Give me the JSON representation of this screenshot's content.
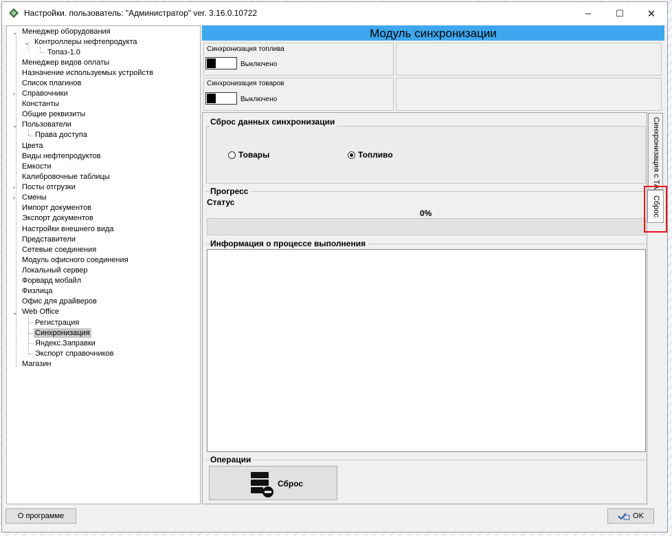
{
  "window": {
    "title": "Настройки. пользователь: \"Администратор\" ver. 3.16.0.10722",
    "minimize": "–",
    "maximize": "☐",
    "close": "✕"
  },
  "tree": {
    "items": [
      {
        "label": "Менеджер оборудования"
      },
      {
        "label": "Контроллеры нефтепродукта"
      },
      {
        "label": "Топаз-1.0"
      },
      {
        "label": "Менеджер видов оплаты"
      },
      {
        "label": "Назначение используемых устройств"
      },
      {
        "label": "Список плагинов"
      },
      {
        "label": "Справочники"
      },
      {
        "label": "Константы"
      },
      {
        "label": "Общие реквизиты"
      },
      {
        "label": "Пользователи"
      },
      {
        "label": "Права доступа"
      },
      {
        "label": "Цвета"
      },
      {
        "label": "Виды нефтепродуктов"
      },
      {
        "label": "Емкости"
      },
      {
        "label": "Калибровочные таблицы"
      },
      {
        "label": "Посты отгрузки"
      },
      {
        "label": "Смены"
      },
      {
        "label": "Импорт документов"
      },
      {
        "label": "Экспорт документов"
      },
      {
        "label": "Настройки внешнего вида"
      },
      {
        "label": "Представители"
      },
      {
        "label": "Сетевые соединения"
      },
      {
        "label": "Модуль офисного соединения"
      },
      {
        "label": "Локальный сервер"
      },
      {
        "label": "Форвард мобайл"
      },
      {
        "label": "Физлица"
      },
      {
        "label": "Офис для драйверов"
      },
      {
        "label": "Web Office"
      },
      {
        "label": "Регистрация"
      },
      {
        "label": "Синхронизация"
      },
      {
        "label": "Яндекс.Заправки"
      },
      {
        "label": "Экспорт справочников"
      },
      {
        "label": "Магазин"
      }
    ],
    "expanded_glyph": "⌄",
    "collapsed_glyph": "›"
  },
  "module": {
    "header": "Модуль синхронизации",
    "fuel_sync_label": "Синхронизация топлива",
    "fuel_sync_state": "Выключено",
    "goods_sync_label": "Синхронизация товаров",
    "goods_sync_state": "Выключено"
  },
  "reset": {
    "group_title": "Сброс данных синхронизации",
    "option_goods": "Товары",
    "option_fuel": "Топливо",
    "selected": "Топливо"
  },
  "progress": {
    "group_title": "Прогресс",
    "status_label": "Статус",
    "percent_text": "0%",
    "value": 0
  },
  "info": {
    "group_title": "Информация о процессе выполнения"
  },
  "operations": {
    "group_title": "Операции",
    "reset_button": "Сброс"
  },
  "tabs": {
    "tab1": "Синхронизация с ТАЗС",
    "tab2": "Сброс"
  },
  "footer": {
    "about_button": "О программе",
    "ok_button": "OK"
  },
  "highlight_color": "#e8141b",
  "header_color": "#3ea7ee"
}
